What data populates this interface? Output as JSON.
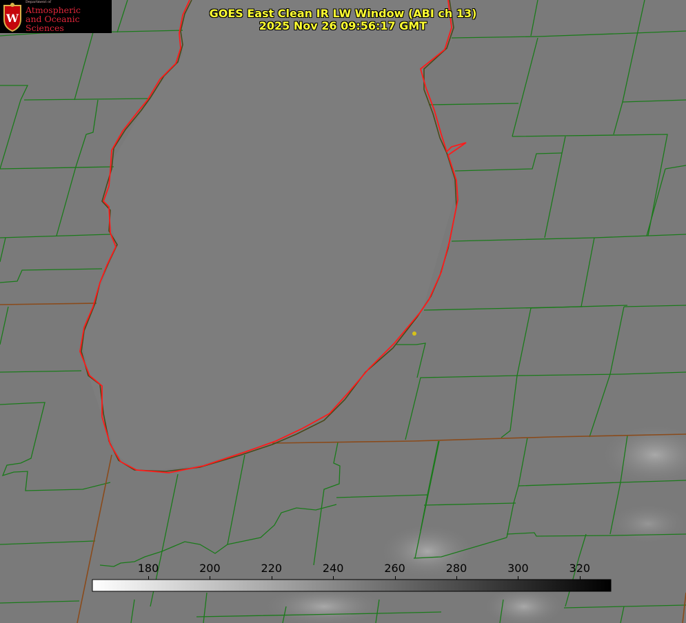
{
  "logo": {
    "department_small": "Department of",
    "line1": "Atmospheric",
    "line2": "and Oceanic Sciences",
    "seal_letter": "W"
  },
  "title": {
    "line1": "GOES East Clean IR LW Window (ABI ch 13)",
    "line2": "2025 Nov 26 09:56:17 GMT"
  },
  "colorbar": {
    "ticks": [
      "180",
      "200",
      "220",
      "240",
      "260",
      "280",
      "300",
      "320"
    ],
    "gradient_start": "#ffffff",
    "gradient_end": "#000000"
  },
  "colors": {
    "county_lines": "#1a7a1a",
    "state_lines": "#8a4a1a",
    "coastline": "#ff2020",
    "title_text": "#ffff33",
    "marker": "#d6c21a"
  },
  "map_layers": {
    "lake": "lake-outline",
    "marker": "location-marker"
  }
}
